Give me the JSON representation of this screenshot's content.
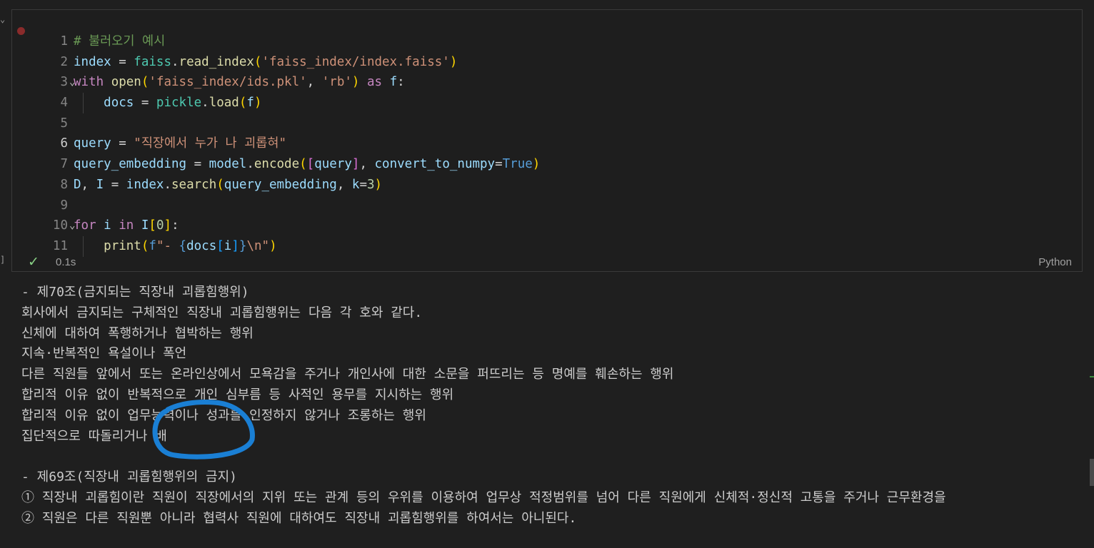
{
  "cell": {
    "lines": [
      {
        "no": "1",
        "tokens": [
          {
            "t": "# 불러오기 예시",
            "c": "cm"
          }
        ]
      },
      {
        "no": "2",
        "tokens": [
          {
            "t": "index",
            "c": "v"
          },
          {
            "t": " = ",
            "c": "p"
          },
          {
            "t": "faiss",
            "c": "c"
          },
          {
            "t": ".",
            "c": "p"
          },
          {
            "t": "read_index",
            "c": "f"
          },
          {
            "t": "(",
            "c": "b1"
          },
          {
            "t": "'faiss_index/index.faiss'",
            "c": "s"
          },
          {
            "t": ")",
            "c": "b1"
          }
        ]
      },
      {
        "no": "3",
        "fold": true,
        "tokens": [
          {
            "t": "with",
            "c": "k"
          },
          {
            "t": " ",
            "c": "p"
          },
          {
            "t": "open",
            "c": "f"
          },
          {
            "t": "(",
            "c": "b1"
          },
          {
            "t": "'faiss_index/ids.pkl'",
            "c": "s"
          },
          {
            "t": ", ",
            "c": "p"
          },
          {
            "t": "'rb'",
            "c": "s"
          },
          {
            "t": ")",
            "c": "b1"
          },
          {
            "t": " ",
            "c": "p"
          },
          {
            "t": "as",
            "c": "k"
          },
          {
            "t": " ",
            "c": "p"
          },
          {
            "t": "f",
            "c": "v"
          },
          {
            "t": ":",
            "c": "p"
          }
        ]
      },
      {
        "no": "4",
        "guide": true,
        "tokens": [
          {
            "t": "    ",
            "c": "p"
          },
          {
            "t": "docs",
            "c": "v"
          },
          {
            "t": " = ",
            "c": "p"
          },
          {
            "t": "pickle",
            "c": "c"
          },
          {
            "t": ".",
            "c": "p"
          },
          {
            "t": "load",
            "c": "f"
          },
          {
            "t": "(",
            "c": "b1"
          },
          {
            "t": "f",
            "c": "v"
          },
          {
            "t": ")",
            "c": "b1"
          }
        ]
      },
      {
        "no": "5",
        "tokens": []
      },
      {
        "no": "6",
        "active": true,
        "tokens": [
          {
            "t": "query",
            "c": "v"
          },
          {
            "t": " = ",
            "c": "p"
          },
          {
            "t": "\"직장에서 누가 나 괴롭혀\"",
            "c": "s"
          }
        ]
      },
      {
        "no": "7",
        "tokens": [
          {
            "t": "query_embedding",
            "c": "v"
          },
          {
            "t": " = ",
            "c": "p"
          },
          {
            "t": "model",
            "c": "v"
          },
          {
            "t": ".",
            "c": "p"
          },
          {
            "t": "encode",
            "c": "f"
          },
          {
            "t": "(",
            "c": "b1"
          },
          {
            "t": "[",
            "c": "b2"
          },
          {
            "t": "query",
            "c": "v"
          },
          {
            "t": "]",
            "c": "b2"
          },
          {
            "t": ", ",
            "c": "p"
          },
          {
            "t": "convert_to_numpy",
            "c": "v"
          },
          {
            "t": "=",
            "c": "p"
          },
          {
            "t": "True",
            "c": "kb"
          },
          {
            "t": ")",
            "c": "b1"
          }
        ]
      },
      {
        "no": "8",
        "tokens": [
          {
            "t": "D",
            "c": "v"
          },
          {
            "t": ", ",
            "c": "p"
          },
          {
            "t": "I",
            "c": "v"
          },
          {
            "t": " = ",
            "c": "p"
          },
          {
            "t": "index",
            "c": "v"
          },
          {
            "t": ".",
            "c": "p"
          },
          {
            "t": "search",
            "c": "f"
          },
          {
            "t": "(",
            "c": "b1"
          },
          {
            "t": "query_embedding",
            "c": "v"
          },
          {
            "t": ", ",
            "c": "p"
          },
          {
            "t": "k",
            "c": "v"
          },
          {
            "t": "=",
            "c": "p"
          },
          {
            "t": "3",
            "c": "n"
          },
          {
            "t": ")",
            "c": "b1"
          }
        ]
      },
      {
        "no": "9",
        "tokens": []
      },
      {
        "no": "10",
        "fold": true,
        "tokens": [
          {
            "t": "for",
            "c": "k"
          },
          {
            "t": " ",
            "c": "p"
          },
          {
            "t": "i",
            "c": "v"
          },
          {
            "t": " ",
            "c": "p"
          },
          {
            "t": "in",
            "c": "k"
          },
          {
            "t": " ",
            "c": "p"
          },
          {
            "t": "I",
            "c": "v"
          },
          {
            "t": "[",
            "c": "b1"
          },
          {
            "t": "0",
            "c": "n"
          },
          {
            "t": "]",
            "c": "b1"
          },
          {
            "t": ":",
            "c": "p"
          }
        ]
      },
      {
        "no": "11",
        "guide": true,
        "tokens": [
          {
            "t": "    ",
            "c": "p"
          },
          {
            "t": "print",
            "c": "f"
          },
          {
            "t": "(",
            "c": "b1"
          },
          {
            "t": "f",
            "c": "kb"
          },
          {
            "t": "\"- ",
            "c": "s"
          },
          {
            "t": "{",
            "c": "kb"
          },
          {
            "t": "docs",
            "c": "v"
          },
          {
            "t": "[",
            "c": "b3"
          },
          {
            "t": "i",
            "c": "v"
          },
          {
            "t": "]",
            "c": "b3"
          },
          {
            "t": "}",
            "c": "kb"
          },
          {
            "t": "\\n",
            "c": "s"
          },
          {
            "t": "\"",
            "c": "s"
          },
          {
            "t": ")",
            "c": "b1"
          }
        ]
      }
    ],
    "status": {
      "time": "0.1s",
      "language": "Python"
    }
  },
  "output": {
    "lines": [
      "- 제70조(금지되는 직장내 괴롭힘행위)",
      "회사에서 금지되는 구체적인 직장내 괴롭힘행위는 다음 각 호와 같다.",
      "신체에 대하여 폭행하거나 협박하는 행위",
      "지속·반복적인 욕설이나 폭언",
      "다른 직원들 앞에서 또는 온라인상에서 모욕감을 주거나 개인사에 대한 소문을 퍼뜨리는 등 명예를 훼손하는 행위",
      "합리적 이유 없이 반복적으로 개인 심부름 등 사적인 용무를 지시하는 행위",
      "합리적 이유 없이 업무능력이나 성과를 인정하지 않거나 조롱하는 행위",
      "집단적으로 따돌리거나 배",
      "",
      "- 제69조(직장내 괴롭힘행위의 금지)",
      "① 직장내 괴롭힘이란 직원이 직장에서의 지위 또는 관계 등의 우위를 이용하여 업무상 적정범위를 넘어 다른 직원에게 신체적·정신적 고통을 주거나 근무환경을",
      "② 직원은 다른 직원뿐 아니라 협력사 직원에 대하여도 직장내 괴롭힘행위를 하여서는 아니된다."
    ]
  },
  "colors": {
    "annotation": "#1a7fd4",
    "check": "#89d185",
    "breakpoint": "#8a2b2b"
  }
}
